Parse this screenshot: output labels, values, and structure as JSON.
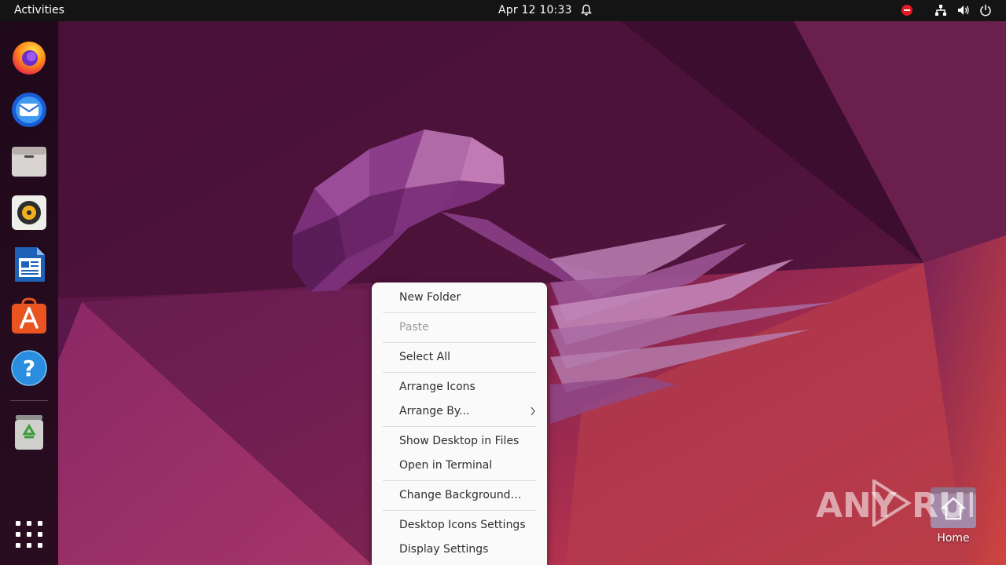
{
  "topbar": {
    "activities": "Activities",
    "clock": "Apr 12  10:33"
  },
  "dock": {
    "items": [
      "firefox-icon",
      "thunderbird-icon",
      "files-icon",
      "rhythmbox-icon",
      "libreoffice-writer-icon",
      "software-center-icon",
      "help-icon",
      "trash-icon",
      "show-apps-icon"
    ]
  },
  "menu": {
    "new_folder": "New Folder",
    "paste": "Paste",
    "select_all": "Select All",
    "arrange_icons": "Arrange Icons",
    "arrange_by": "Arrange By...",
    "show_desktop_in_files": "Show Desktop in Files",
    "open_in_terminal": "Open in Terminal",
    "change_background": "Change Background…",
    "desktop_icons_settings": "Desktop Icons Settings",
    "display_settings": "Display Settings"
  },
  "desktop": {
    "home_label": "Home"
  },
  "watermark": {
    "text": "ANY RUN"
  },
  "colors": {
    "topbar": "#141414",
    "menu_bg": "#fafafa",
    "accent_red": "#e01b24",
    "ubuntu_orange": "#e95420"
  }
}
